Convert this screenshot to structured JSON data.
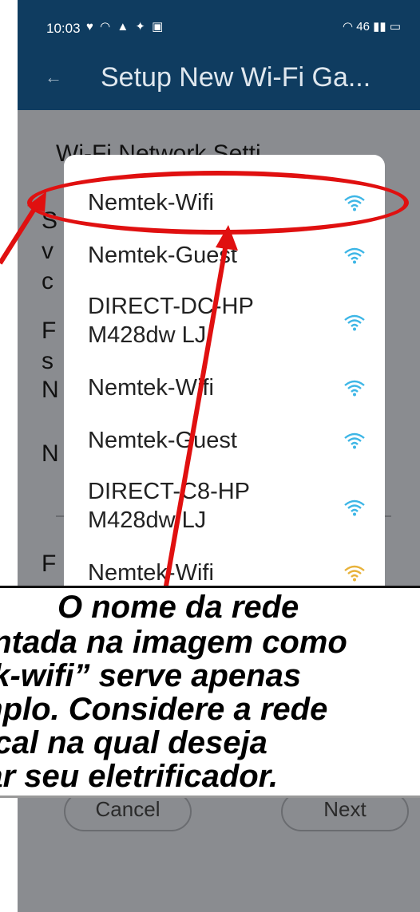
{
  "status_bar": {
    "time": "10:03",
    "left_icons": "♥ ◠ ▲ ✦ ▣",
    "right_icons": "◠ 46 ▮▮ ▭"
  },
  "app_bar": {
    "title": "Setup New Wi-Fi Ga...",
    "back_icon": "back-arrow-icon"
  },
  "background": {
    "heading": "Wi-Fi Network Setti",
    "partial_letters": [
      "S",
      "v",
      "c",
      "F",
      "s",
      "N",
      "N",
      "F"
    ]
  },
  "networks": [
    {
      "name": "Nemtek-Wifi",
      "signal_color": "#3db6e6"
    },
    {
      "name": "Nemtek-Guest",
      "signal_color": "#3db6e6"
    },
    {
      "name": "DIRECT-DC-HP\nM428dw LJ",
      "signal_color": "#3db6e6"
    },
    {
      "name": "Nemtek-Wifi",
      "signal_color": "#3db6e6"
    },
    {
      "name": "Nemtek-Guest",
      "signal_color": "#3db6e6"
    },
    {
      "name": "DIRECT-C8-HP\nM428dw LJ",
      "signal_color": "#3db6e6"
    },
    {
      "name": "Nemtek-Wifi",
      "signal_color": "#e8b23a"
    }
  ],
  "caption_lines": [
    "O nome da rede",
    "entada na imagem como",
    "ek-wifi” serve apenas",
    "mplo. Considere a rede",
    "ocal na qual deseja",
    "tar seu eletrificador."
  ],
  "buttons": {
    "cancel": "Cancel",
    "next": "Next"
  },
  "colors": {
    "app_bar": "#0f3c60",
    "annotation_red": "#e01010",
    "wifi_blue": "#3db6e6"
  }
}
